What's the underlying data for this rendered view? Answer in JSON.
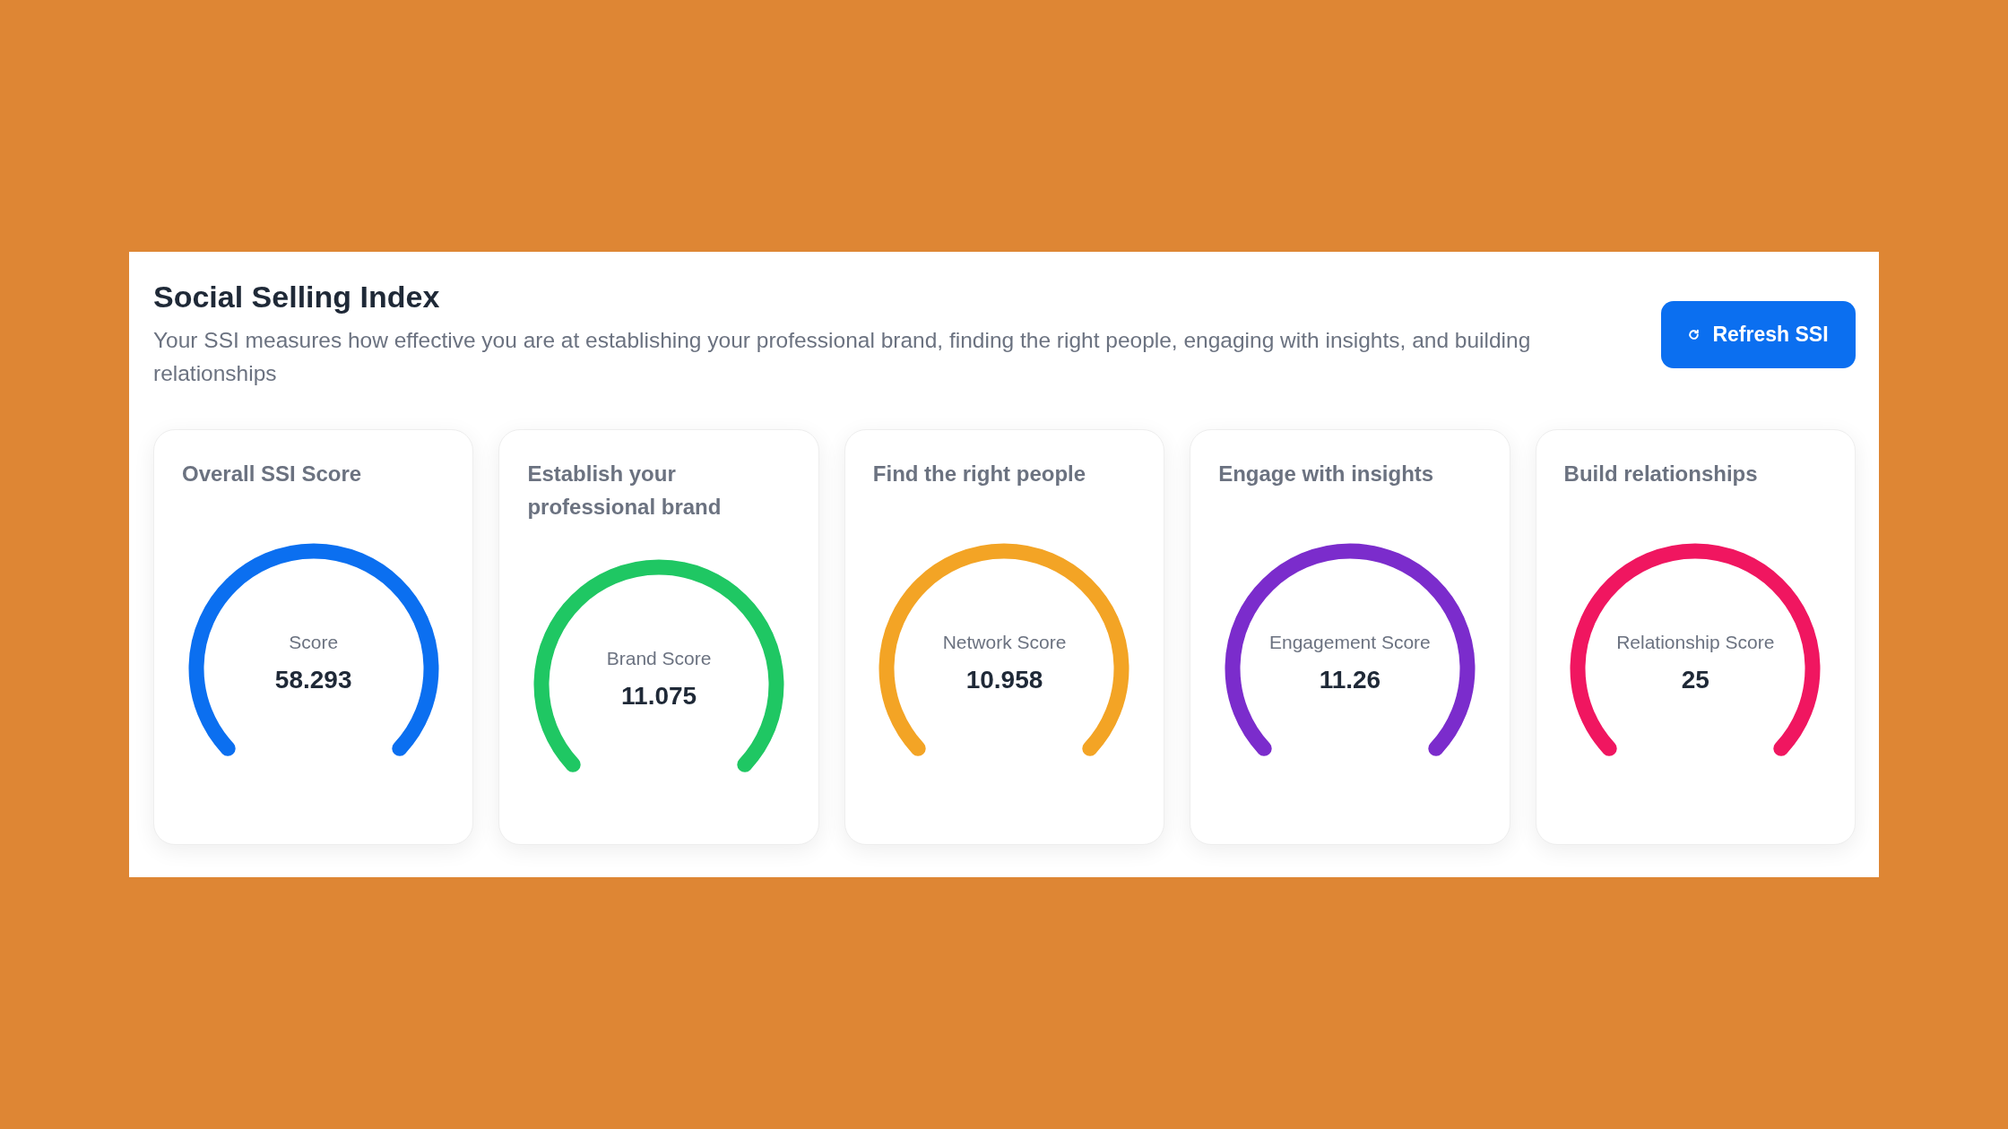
{
  "header": {
    "title": "Social Selling Index",
    "description": "Your SSI measures how effective you are at establishing your professional brand, finding the right people, engaging with insights, and building relationships",
    "refresh_button": "Refresh SSI"
  },
  "cards": [
    {
      "title": "Overall SSI Score",
      "label": "Score",
      "value": "58.293",
      "color": "#0b6ff0"
    },
    {
      "title": "Establish your professional brand",
      "label": "Brand Score",
      "value": "11.075",
      "color": "#1fc763"
    },
    {
      "title": "Find the right people",
      "label": "Network Score",
      "value": "10.958",
      "color": "#f3a425"
    },
    {
      "title": "Engage with insights",
      "label": "Engagement Score",
      "value": "11.26",
      "color": "#7b2ccc"
    },
    {
      "title": "Build relationships",
      "label": "Relationship Score",
      "value": "25",
      "color": "#f01660"
    }
  ]
}
